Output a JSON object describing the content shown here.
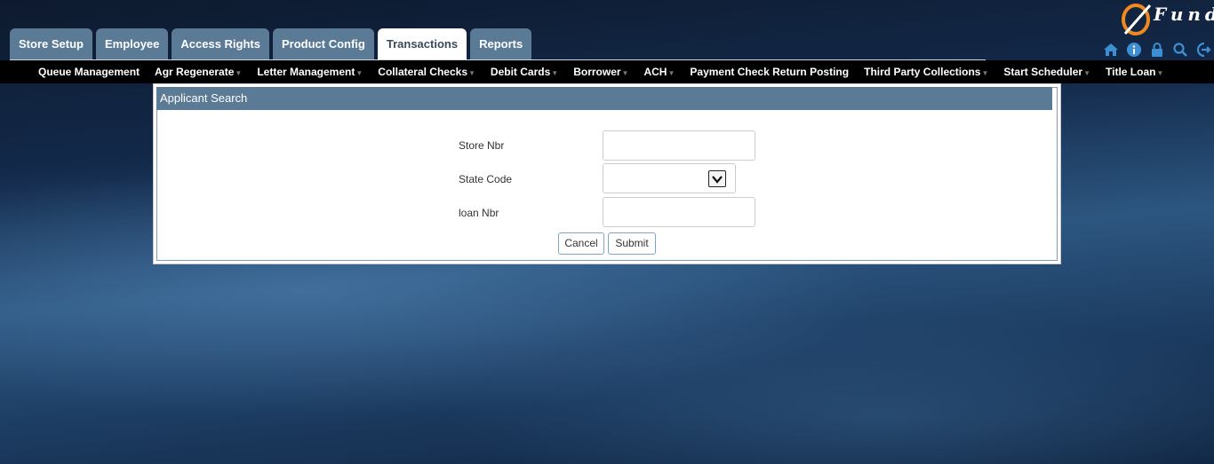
{
  "top_tabs": [
    {
      "label": "Store Setup",
      "active": false
    },
    {
      "label": "Employee",
      "active": false
    },
    {
      "label": "Access Rights",
      "active": false
    },
    {
      "label": "Product Config",
      "active": false
    },
    {
      "label": "Transactions",
      "active": true
    },
    {
      "label": "Reports",
      "active": false
    }
  ],
  "logo": {
    "text": "Fund"
  },
  "header_icons": [
    "home-icon",
    "info-icon",
    "lock-icon",
    "search-icon",
    "logout-icon"
  ],
  "menu": [
    {
      "label": "Queue Management",
      "has_caret": false
    },
    {
      "label": "Agr Regenerate",
      "has_caret": true
    },
    {
      "label": "Letter Management",
      "has_caret": true
    },
    {
      "label": "Collateral Checks",
      "has_caret": true
    },
    {
      "label": "Debit Cards",
      "has_caret": true
    },
    {
      "label": "Borrower",
      "has_caret": true
    },
    {
      "label": "ACH",
      "has_caret": true
    },
    {
      "label": "Payment Check Return Posting",
      "has_caret": false
    },
    {
      "label": "Third Party Collections",
      "has_caret": true
    },
    {
      "label": "Start Scheduler",
      "has_caret": true
    },
    {
      "label": "Title Loan",
      "has_caret": true
    }
  ],
  "panel": {
    "title": "Applicant Search",
    "fields": {
      "store_nbr": {
        "label": "Store Nbr",
        "value": ""
      },
      "state_code": {
        "label": "State Code",
        "value": ""
      },
      "loan_nbr": {
        "label": "loan Nbr",
        "value": ""
      }
    },
    "cancel_label": "Cancel",
    "submit_label": "Submit"
  },
  "colors": {
    "tab_bg": "#5b7a95",
    "menubar_bg": "#000000",
    "panel_header_bg": "#5b7a95",
    "icon_color": "#3d8fd1",
    "logo_accent": "#f08a1e"
  }
}
